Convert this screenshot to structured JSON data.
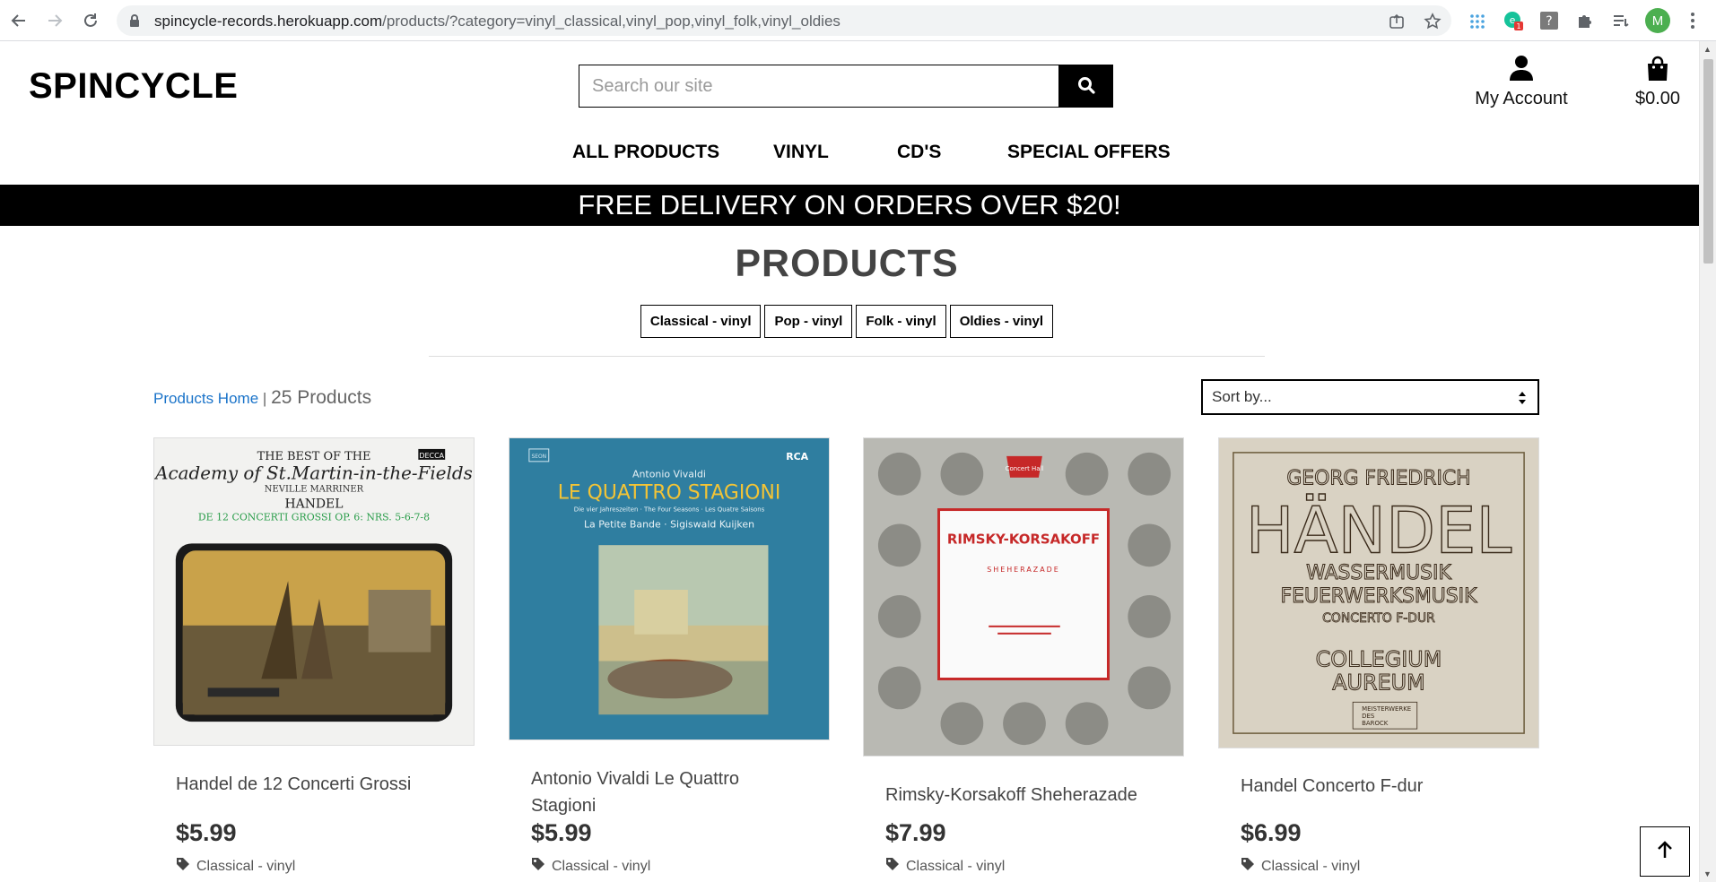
{
  "browser": {
    "url_host": "spincycle-records.herokuapp.com",
    "url_path": "/products/?category=vinyl_classical,vinyl_pop,vinyl_folk,vinyl_oldies",
    "profile_initial": "M",
    "ext_badge": "1"
  },
  "site": {
    "logo": "SPINCYCLE",
    "search_placeholder": "Search our site",
    "account_label": "My Account",
    "bag_total": "$0.00"
  },
  "nav": [
    "ALL PRODUCTS",
    "VINYL",
    "CD'S",
    "SPECIAL OFFERS"
  ],
  "banner": "FREE DELIVERY ON ORDERS OVER $20!",
  "page": {
    "title": "PRODUCTS",
    "categories": [
      "Classical - vinyl",
      "Pop - vinyl",
      "Folk - vinyl",
      "Oldies - vinyl"
    ],
    "breadcrumb_link": "Products Home",
    "separator": "|",
    "count": "25 Products",
    "sort_label": "Sort by..."
  },
  "products": [
    {
      "name": "Handel de 12 Concerti Grossi",
      "price": "$5.99",
      "category": "Classical - vinyl",
      "cover_text": [
        "THE BEST OF THE",
        "Academy of St.Martin-in-the-Fields",
        "NEVILLE MARRINER",
        "HANDEL",
        "DE 12 CONCERTI GROSSI OP. 6: NRS. 5-6-7-8",
        "DECCA"
      ]
    },
    {
      "name": "Antonio Vivaldi Le Quattro Stagioni",
      "price": "$5.99",
      "category": "Classical - vinyl",
      "cover_text": [
        "Antonio Vivaldi",
        "LE QUATTRO STAGIONI",
        "Die vier Jahreszeiten · The Four Seasons · Les Quatre Saisons",
        "La Petite Bande · Sigiswald Kuijken",
        "RCA",
        "SEON"
      ]
    },
    {
      "name": "Rimsky-Korsakoff Sheherazade",
      "price": "$7.99",
      "category": "Classical - vinyl",
      "cover_text": [
        "RIMSKY-KORSAKOFF",
        "SHEHERAZADE",
        "Concert Hall"
      ]
    },
    {
      "name": "Handel Concerto F-dur",
      "price": "$6.99",
      "category": "Classical - vinyl",
      "cover_text": [
        "GEORG FRIEDRICH",
        "HÄNDEL",
        "WASSERMUSIK",
        "FEUERWERKSMUSIK",
        "CONCERTO F-DUR",
        "COLLEGIUM",
        "AUREUM",
        "MEISTERWERKE",
        "DES",
        "BAROCK"
      ]
    }
  ],
  "colors": {
    "banner_bg": "#000000",
    "link_blue": "#1a73c9",
    "text_grey": "#444444"
  },
  "icons": [
    "back-arrow-icon",
    "forward-arrow-icon",
    "reload-icon",
    "lock-icon",
    "share-icon",
    "star-icon",
    "search-icon",
    "user-icon",
    "shopping-bag-icon",
    "tag-icon",
    "arrow-up-icon"
  ]
}
